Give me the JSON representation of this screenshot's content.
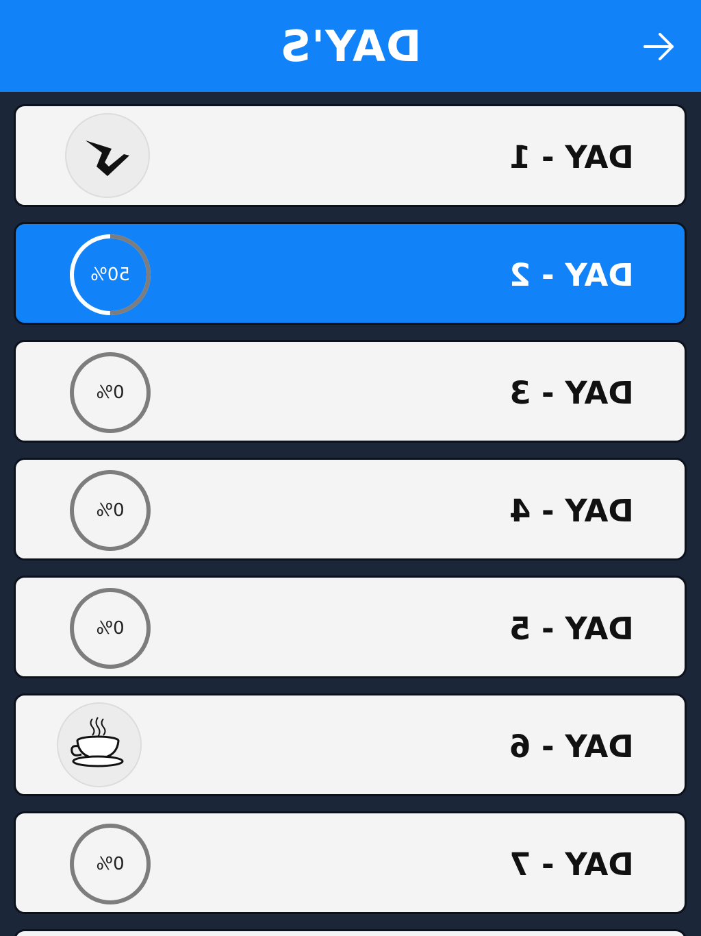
{
  "header": {
    "title": "DAY'S",
    "next_icon": "arrow-right-icon"
  },
  "days": [
    {
      "label": "DAY - 1",
      "status": "completed",
      "icon": "checkmark-icon"
    },
    {
      "label": "DAY - 2",
      "status": "in-progress",
      "progress_text": "50%",
      "progress": 0.5
    },
    {
      "label": "DAY - 3",
      "status": "pending",
      "progress_text": "0%",
      "progress": 0
    },
    {
      "label": "DAY - 4",
      "status": "pending",
      "progress_text": "0%",
      "progress": 0
    },
    {
      "label": "DAY - 5",
      "status": "pending",
      "progress_text": "0%",
      "progress": 0
    },
    {
      "label": "DAY - 6",
      "status": "rest",
      "icon": "coffee-cup-icon"
    },
    {
      "label": "DAY - 7",
      "status": "pending",
      "progress_text": "0%",
      "progress": 0
    }
  ],
  "colors": {
    "accent": "#1282f8",
    "background": "#1b2638",
    "card": "#f4f4f4",
    "ring": "#7d7d7d"
  }
}
